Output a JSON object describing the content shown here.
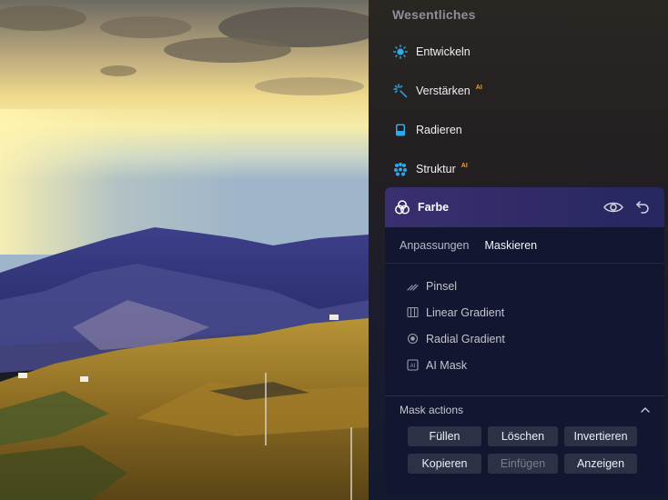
{
  "panel": {
    "section_title": "Wesentliches",
    "tools": [
      {
        "label": "Entwickeln",
        "icon": "sun-icon",
        "ai": ""
      },
      {
        "label": "Verstärken",
        "icon": "sparkle-icon",
        "ai": "AI"
      },
      {
        "label": "Radieren",
        "icon": "eraser-icon",
        "ai": ""
      },
      {
        "label": "Struktur",
        "icon": "structure-dots-icon",
        "ai": "AI"
      }
    ],
    "active_tool": {
      "label": "Farbe",
      "icon": "color-circles-icon",
      "tabs": [
        "Anpassungen",
        "Maskieren"
      ],
      "active_tab": "Maskieren",
      "mask_tools": [
        {
          "label": "Pinsel",
          "icon": "brush-icon"
        },
        {
          "label": "Linear Gradient",
          "icon": "linear-gradient-icon"
        },
        {
          "label": "Radial Gradient",
          "icon": "radial-gradient-icon"
        },
        {
          "label": "AI Mask",
          "icon": "ai-mask-icon"
        }
      ],
      "mask_actions": {
        "title": "Mask actions",
        "buttons": [
          {
            "label": "Füllen",
            "enabled": true
          },
          {
            "label": "Löschen",
            "enabled": true
          },
          {
            "label": "Invertieren",
            "enabled": true
          },
          {
            "label": "Kopieren",
            "enabled": true
          },
          {
            "label": "Einfügen",
            "enabled": false
          },
          {
            "label": "Anzeigen",
            "enabled": true
          }
        ]
      }
    }
  },
  "colors": {
    "accent_blue": "#2fa8e8",
    "ai_badge": "#f0a040",
    "card_header": "#2e2a66"
  }
}
